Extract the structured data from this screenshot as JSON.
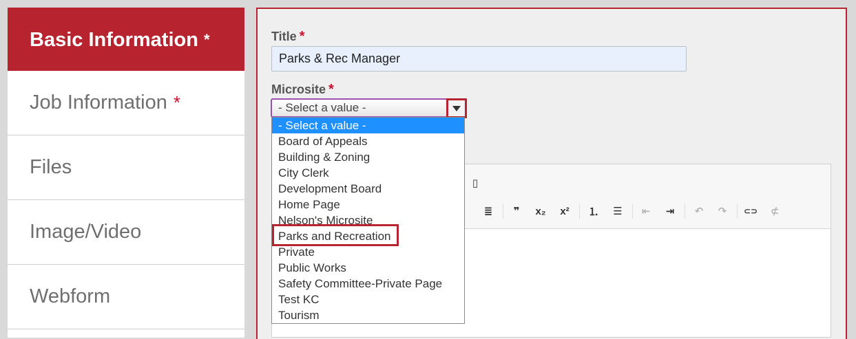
{
  "sidebar": {
    "items": [
      {
        "label": "Basic Information",
        "required": "*"
      },
      {
        "label": "Job Information",
        "required": "*"
      },
      {
        "label": "Files"
      },
      {
        "label": "Image/Video"
      },
      {
        "label": "Webform"
      }
    ]
  },
  "form": {
    "title_label": "Title",
    "title_required": "*",
    "title_value": "Parks & Rec Manager",
    "microsite_label": "Microsite",
    "microsite_required": "*",
    "microsite_selected": "- Select a value -",
    "microsite_options": [
      "- Select a value -",
      "Board of Appeals",
      "Building & Zoning",
      "City Clerk",
      "Development Board",
      "Home Page",
      "Nelson's Microsite",
      "Parks and Recreation",
      "Private",
      "Public Works",
      "Safety Committee-Private Page",
      "Test KC",
      "Tourism"
    ]
  },
  "editor_toolbar": {
    "icons": [
      "template-icon",
      "align-justify-icon",
      "blockquote-icon",
      "subscript-icon",
      "superscript-icon",
      "numbered-list-icon",
      "bulleted-list-icon",
      "outdent-icon",
      "indent-icon",
      "undo-icon",
      "redo-icon",
      "link-icon",
      "unlink-icon"
    ],
    "glyphs": {
      "template": "▯",
      "justify": "≣",
      "quote": "❞",
      "subscript": "x₂",
      "superscript": "x²",
      "numlist": "⒈",
      "bullist": "☰",
      "outdent": "⇤",
      "indent": "⇥",
      "undo": "↶",
      "redo": "↷",
      "link": "⊂⊃",
      "unlink": "⊄"
    }
  },
  "colors": {
    "accent": "#b7232e",
    "selected_option": "#1e90ff",
    "input_bg": "#e8f0fe"
  }
}
